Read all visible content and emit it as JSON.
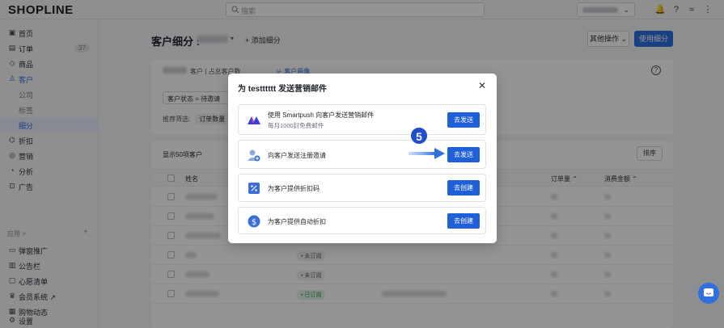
{
  "topbar": {
    "logo": "SHOPLINE",
    "search_placeholder": "搜索"
  },
  "sidebar": {
    "items": [
      {
        "label": "首页",
        "icon": "home-icon"
      },
      {
        "label": "订单",
        "icon": "order-icon",
        "badge": "37"
      },
      {
        "label": "商品",
        "icon": "product-icon"
      },
      {
        "label": "客户",
        "icon": "customer-icon"
      },
      {
        "label": "公司",
        "icon": ""
      },
      {
        "label": "标签",
        "icon": ""
      },
      {
        "label": "细分",
        "icon": ""
      },
      {
        "label": "折扣",
        "icon": "discount-icon"
      },
      {
        "label": "营销",
        "icon": "marketing-icon"
      },
      {
        "label": "分析",
        "icon": "analytics-icon"
      },
      {
        "label": "广告",
        "icon": "ads-icon"
      }
    ],
    "apps_label": "应用 >",
    "apps": [
      {
        "label": "弹窗推广",
        "icon": "popup-icon"
      },
      {
        "label": "公告栏",
        "icon": "announcement-icon"
      },
      {
        "label": "心愿清单",
        "icon": "wishlist-icon"
      },
      {
        "label": "会员系统 ↗",
        "icon": "member-icon"
      },
      {
        "label": "购物动态",
        "icon": "activity-icon"
      }
    ],
    "settings": "设置"
  },
  "page": {
    "title": "客户细分 :",
    "add_segment": "+ 添加细分",
    "more_actions": "其他操作 ⌄",
    "use_segment": "使用细分",
    "customer_meta": "客户 | 占总客户数",
    "profile_link": "⊬ 客户画像",
    "filter_text": "客户状态 = 待邀请",
    "applied_filters_label": "推荐筛选:",
    "applied_filters_chip": "订单数量",
    "count_label": "显示50项客户",
    "sort_button": "排序",
    "columns": {
      "name": "姓名",
      "orders": "订单量 ⌃",
      "spend": "消费金额 ⌃"
    },
    "rows": [
      {
        "status": ""
      },
      {
        "status": ""
      },
      {
        "status": ""
      },
      {
        "status": ""
      },
      {
        "status": "• 未订阅"
      },
      {
        "status": "• 未订阅"
      },
      {
        "status": "• 已订阅"
      }
    ]
  },
  "modal": {
    "title": "为 testttttt 发送营销邮件",
    "options": [
      {
        "label": "使用 Smartpush 向客户发送营销邮件",
        "sub": "每月1000封免费邮件",
        "button": "去发送",
        "icon": "smartpush-icon"
      },
      {
        "label": "向客户发送注册邀请",
        "sub": "",
        "button": "去发送",
        "icon": "invite-user-icon"
      },
      {
        "label": "为客户提供折扣码",
        "sub": "",
        "button": "去创建",
        "icon": "discount-code-icon"
      },
      {
        "label": "为客户提供自动折扣",
        "sub": "",
        "button": "去创建",
        "icon": "auto-discount-icon"
      }
    ]
  },
  "annotation": {
    "step": "5"
  },
  "colors": {
    "primary": "#1f5fd8",
    "accent": "#2f6fe0",
    "step_marker": "#1f4fc9"
  }
}
